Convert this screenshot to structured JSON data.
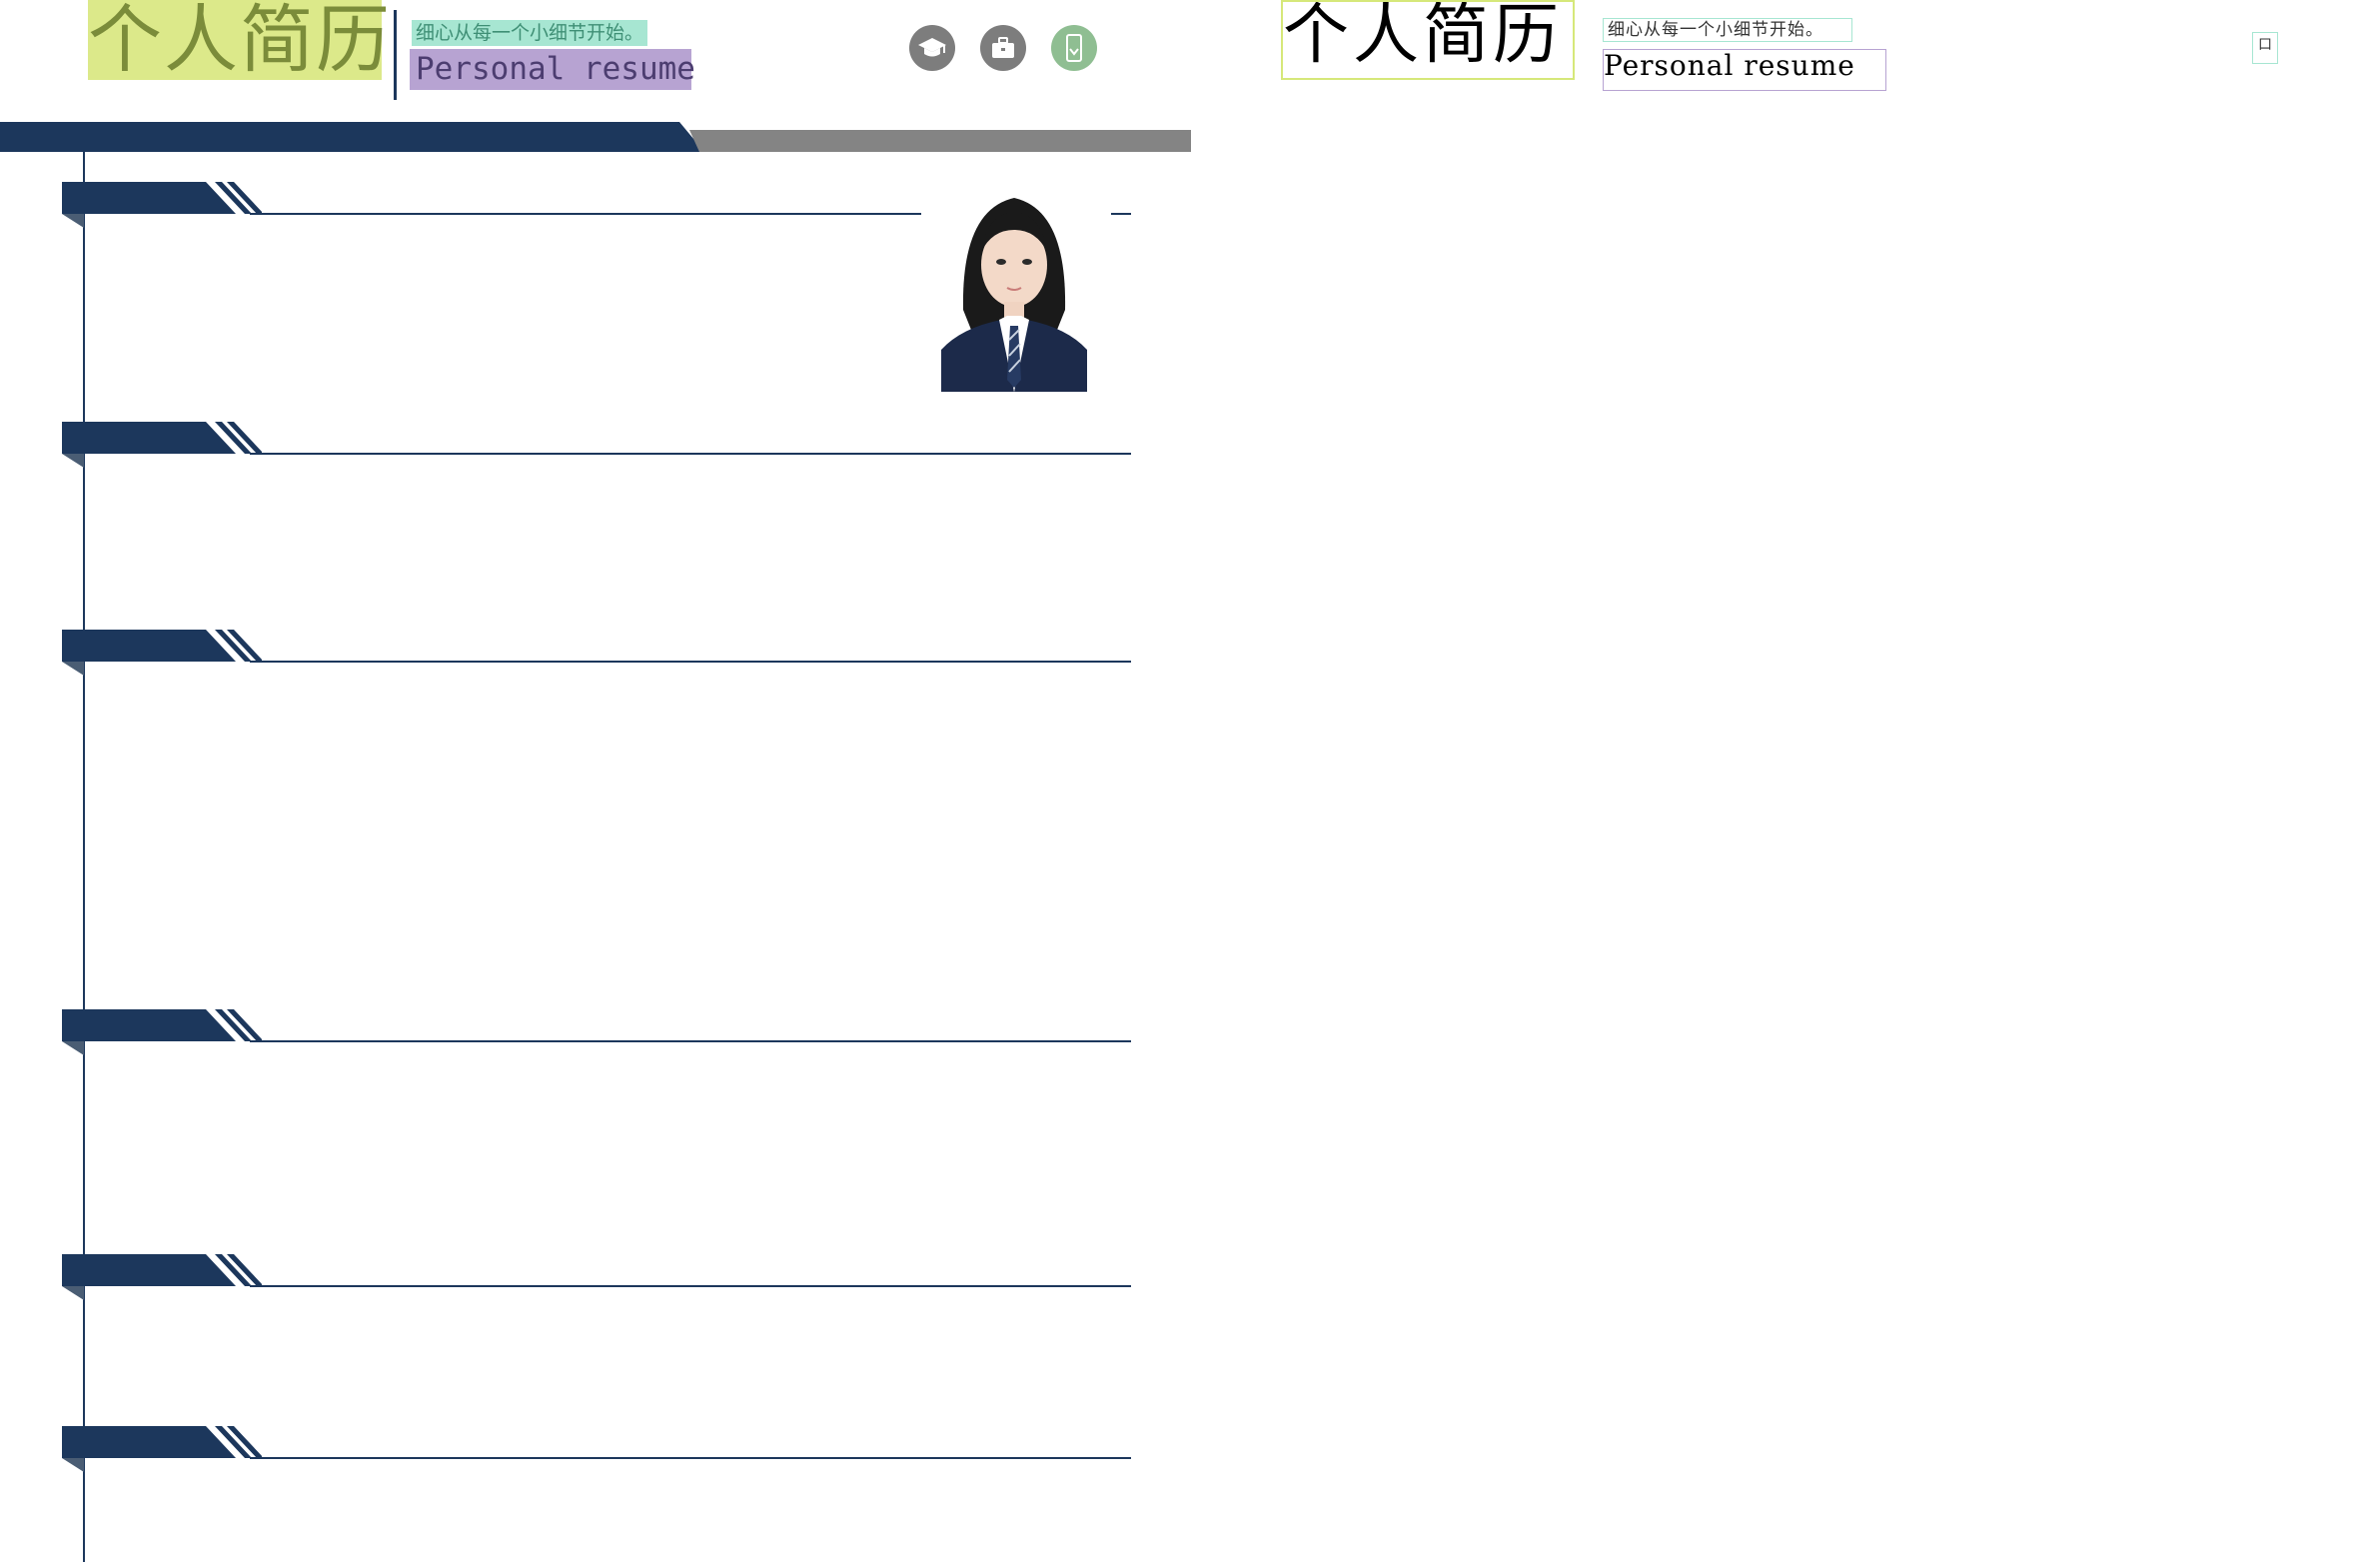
{
  "resume": {
    "title_cn": "个人简历",
    "tagline": "细心从每一个小细节开始。",
    "title_en": "Personal resume",
    "icons": [
      "graduation-cap-icon",
      "briefcase-icon",
      "phone-icon"
    ],
    "section_count": 6
  },
  "overlay": {
    "title_cn": "个人简历",
    "tagline": "细心从每一个小细节开始。",
    "title_en": "Personal resume",
    "glyph": "口"
  },
  "colors": {
    "navy": "#1c375c",
    "gray_band": "#848484",
    "icon_gray": "#7d7d7d",
    "icon_green": "#8fbe92",
    "title_cn_bg": "#dce98a",
    "tagline_bg": "#a7e6d2",
    "title_en_bg": "#b7a3d2"
  }
}
